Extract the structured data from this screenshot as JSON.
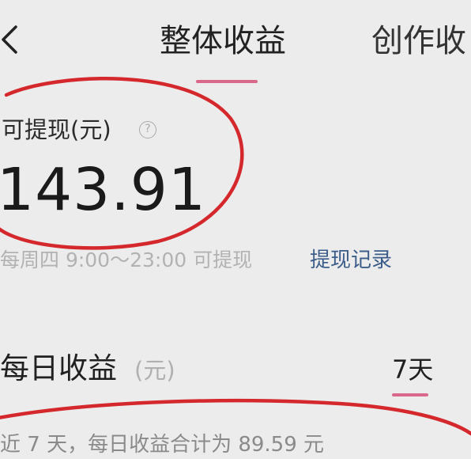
{
  "header": {
    "tabs": [
      {
        "label": "整体收益",
        "active": true
      },
      {
        "label": "创作收",
        "active": false
      }
    ]
  },
  "balance": {
    "label": "可提现(元)",
    "help_icon": "question-circle-icon",
    "value": "143.91"
  },
  "withdraw": {
    "schedule": "每周四 9:00～23:00 可提现",
    "record_link": "提现记录"
  },
  "daily": {
    "title": "每日收益",
    "unit": "(元)",
    "range_tab": "7天",
    "summary": "近 7 天，每日收益合计为 89.59 元"
  },
  "colors": {
    "accent": "#d9688a",
    "link": "#3c5d8a",
    "annotation": "#d4282c",
    "background": "#ececec"
  }
}
